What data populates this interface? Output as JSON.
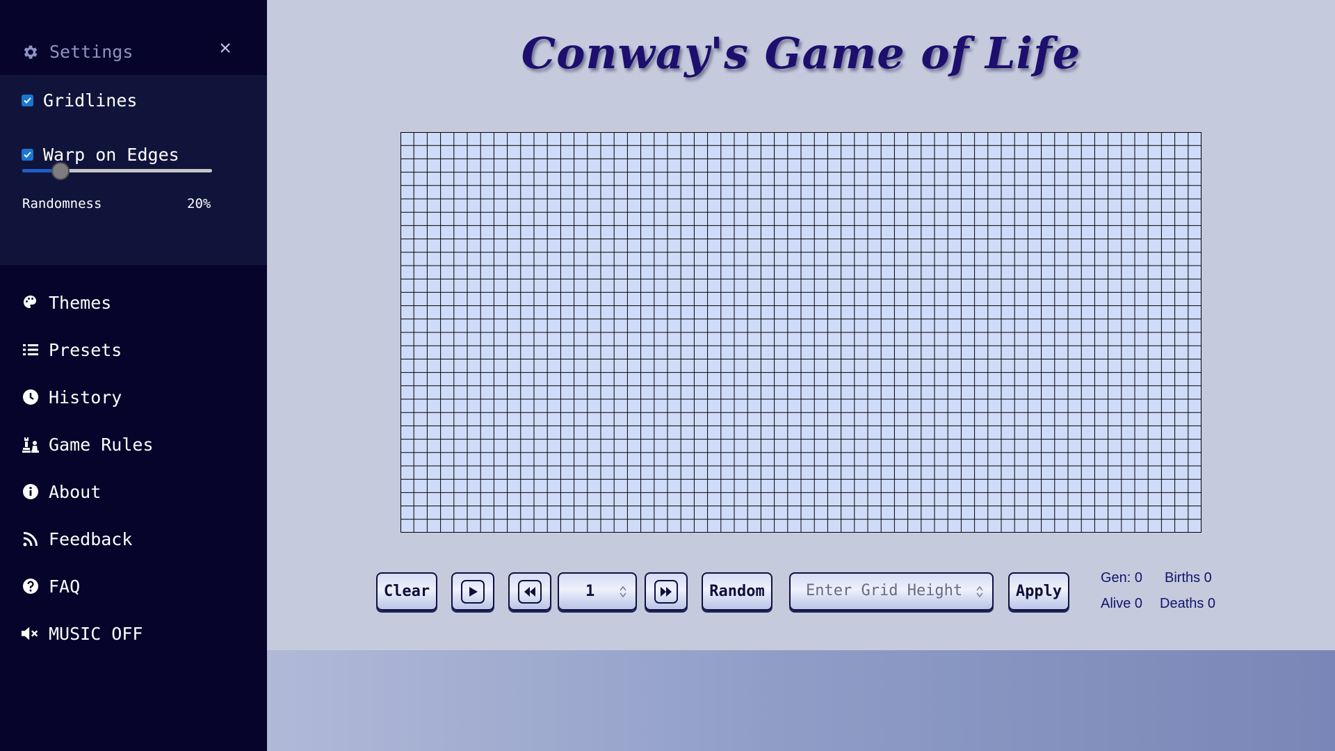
{
  "sidebar": {
    "settings_title": "Settings",
    "gridlines_label": "Gridlines",
    "gridlines_checked": true,
    "warp_label": "Warp on Edges",
    "warp_checked": true,
    "randomness_label": "Randomness",
    "randomness_value": "20%",
    "randomness_fraction": 0.2,
    "nav": [
      {
        "label": "Themes",
        "icon": "palette-icon"
      },
      {
        "label": "Presets",
        "icon": "list-icon"
      },
      {
        "label": "History",
        "icon": "clock-icon"
      },
      {
        "label": "Game Rules",
        "icon": "chess-icon"
      },
      {
        "label": "About",
        "icon": "info-icon"
      },
      {
        "label": "Feedback",
        "icon": "rss-icon"
      },
      {
        "label": "FAQ",
        "icon": "question-icon"
      },
      {
        "label": "MUSIC OFF",
        "icon": "volume-mute-icon"
      }
    ]
  },
  "main": {
    "title": "Conway's Game of Life",
    "grid": {
      "columns": 60,
      "rows": 30,
      "cell_color": "#cfdcf9",
      "line_color": "#000000"
    }
  },
  "controls": {
    "clear_label": "Clear",
    "speed_value": "1",
    "random_label": "Random",
    "height_placeholder": "Enter Grid Height",
    "apply_label": "Apply"
  },
  "stats": {
    "gen": "Gen: 0",
    "births": "Births 0",
    "alive": "Alive 0",
    "deaths": "Deaths 0"
  },
  "colors": {
    "sidebar_bg": "#06042a",
    "settings_panel_bg": "#10143a",
    "accent": "#1976d2",
    "page_bg": "#c5cbdd",
    "title": "#1d0f6e"
  }
}
